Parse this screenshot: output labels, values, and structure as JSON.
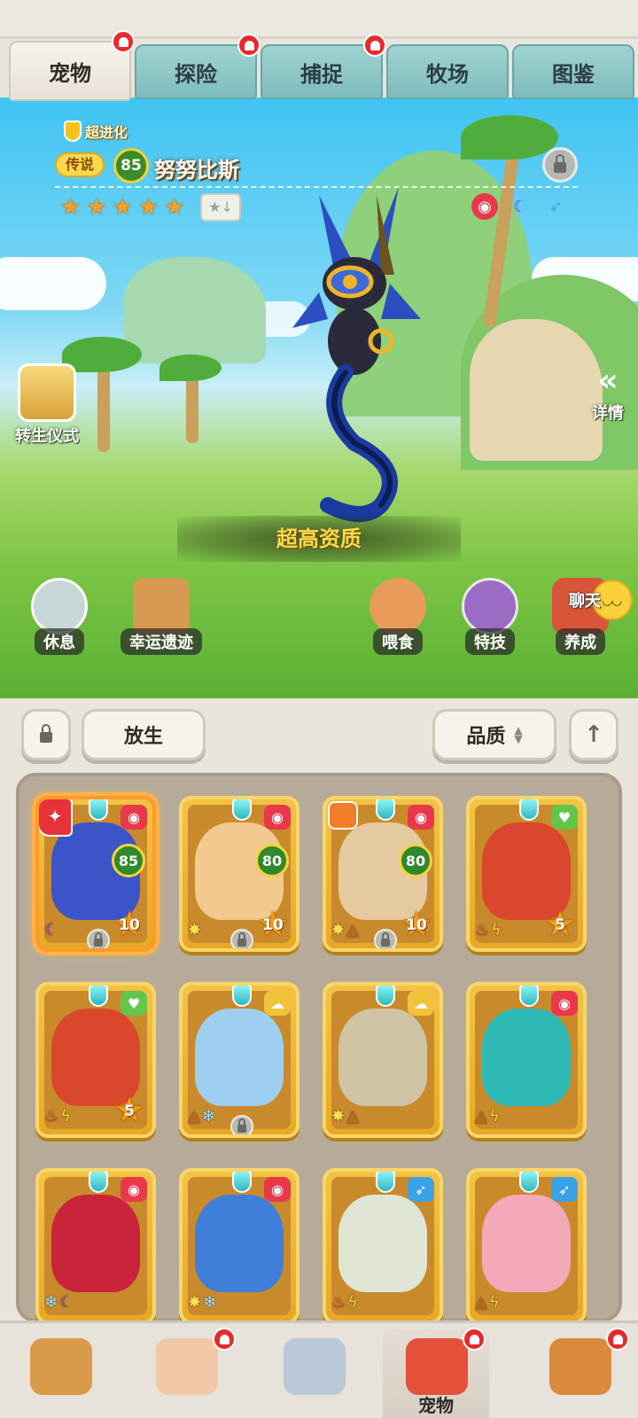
{
  "tabs": [
    {
      "label": "宠物",
      "active": true,
      "badge": true
    },
    {
      "label": "探险",
      "active": false,
      "badge": true
    },
    {
      "label": "捕捉",
      "active": false,
      "badge": true
    },
    {
      "label": "牧场",
      "active": false,
      "badge": false
    },
    {
      "label": "图鉴",
      "active": false,
      "badge": false
    }
  ],
  "pet": {
    "evolution": "超进化",
    "rarity": "传说",
    "level": "85",
    "name": "努努比斯",
    "stars": 5,
    "quality": "超高资质",
    "elements": [
      "beast-icon",
      "moon-icon",
      "wind-icon"
    ]
  },
  "side": {
    "rebirth": "转生仪式",
    "details": "详情"
  },
  "actions": {
    "rest": "休息",
    "lucky_ruins": "幸运遗迹",
    "feed": "喂食",
    "skill": "特技",
    "train": "养成",
    "chat": "聊天"
  },
  "controls": {
    "release": "放生",
    "sort": "品质"
  },
  "cards": [
    {
      "level": "85",
      "rank": "10",
      "corner": "beast",
      "selected": true,
      "locked": true,
      "tag": "feature",
      "elements": [
        "moon"
      ],
      "art": "#3b55c9"
    },
    {
      "level": "80",
      "rank": "10",
      "corner": "beast",
      "selected": false,
      "locked": true,
      "tag": "",
      "elements": [
        "light"
      ],
      "art": "#f2c98e"
    },
    {
      "level": "80",
      "rank": "10",
      "corner": "beast",
      "selected": false,
      "locked": true,
      "tag": "trait",
      "elements": [
        "light",
        "earth"
      ],
      "art": "#e5c9a0"
    },
    {
      "level": "",
      "rank": "5",
      "corner": "heart",
      "selected": false,
      "locked": false,
      "tag": "",
      "elements": [
        "fire",
        "thunder"
      ],
      "art": "#d9482c"
    },
    {
      "level": "",
      "rank": "5",
      "corner": "heart",
      "selected": false,
      "locked": false,
      "tag": "",
      "elements": [
        "fire",
        "thunder"
      ],
      "art": "#d9482c"
    },
    {
      "level": "",
      "rank": "",
      "corner": "cloud",
      "selected": false,
      "locked": true,
      "tag": "",
      "elements": [
        "earth",
        "ice"
      ],
      "art": "#9fcff0"
    },
    {
      "level": "",
      "rank": "",
      "corner": "cloud",
      "selected": false,
      "locked": false,
      "tag": "",
      "elements": [
        "light",
        "earth"
      ],
      "art": "#cfc4a4"
    },
    {
      "level": "",
      "rank": "",
      "corner": "beast",
      "selected": false,
      "locked": false,
      "tag": "",
      "elements": [
        "earth",
        "thunder"
      ],
      "art": "#2fb9b5"
    },
    {
      "level": "",
      "rank": "",
      "corner": "beast",
      "selected": false,
      "locked": false,
      "tag": "",
      "elements": [
        "ice",
        "moon"
      ],
      "art": "#c9243a"
    },
    {
      "level": "",
      "rank": "",
      "corner": "beast",
      "selected": false,
      "locked": false,
      "tag": "",
      "elements": [
        "light",
        "ice"
      ],
      "art": "#3f7fd9"
    },
    {
      "level": "",
      "rank": "",
      "corner": "wind",
      "selected": false,
      "locked": false,
      "tag": "",
      "elements": [
        "fire",
        "thunder"
      ],
      "art": "#dfe6d4"
    },
    {
      "level": "",
      "rank": "",
      "corner": "wind",
      "selected": false,
      "locked": false,
      "tag": "",
      "elements": [
        "earth",
        "thunder"
      ],
      "art": "#f4a9b8"
    }
  ],
  "nav": [
    {
      "label": "",
      "icon": "tribe-chief-icon",
      "badge": false,
      "active": false
    },
    {
      "label": "",
      "icon": "character-icon",
      "badge": true,
      "active": false
    },
    {
      "label": "",
      "icon": "battle-sword-icon",
      "badge": false,
      "active": false
    },
    {
      "label": "宠物",
      "icon": "pet-icon",
      "badge": true,
      "active": true
    },
    {
      "label": "",
      "icon": "shop-icon",
      "badge": true,
      "active": false
    }
  ],
  "colors": {
    "card_gold": "#f3c345",
    "tab_teal": "#9fd3d2",
    "badge_red": "#e7292c",
    "quality_gold": "#ffd94a"
  }
}
